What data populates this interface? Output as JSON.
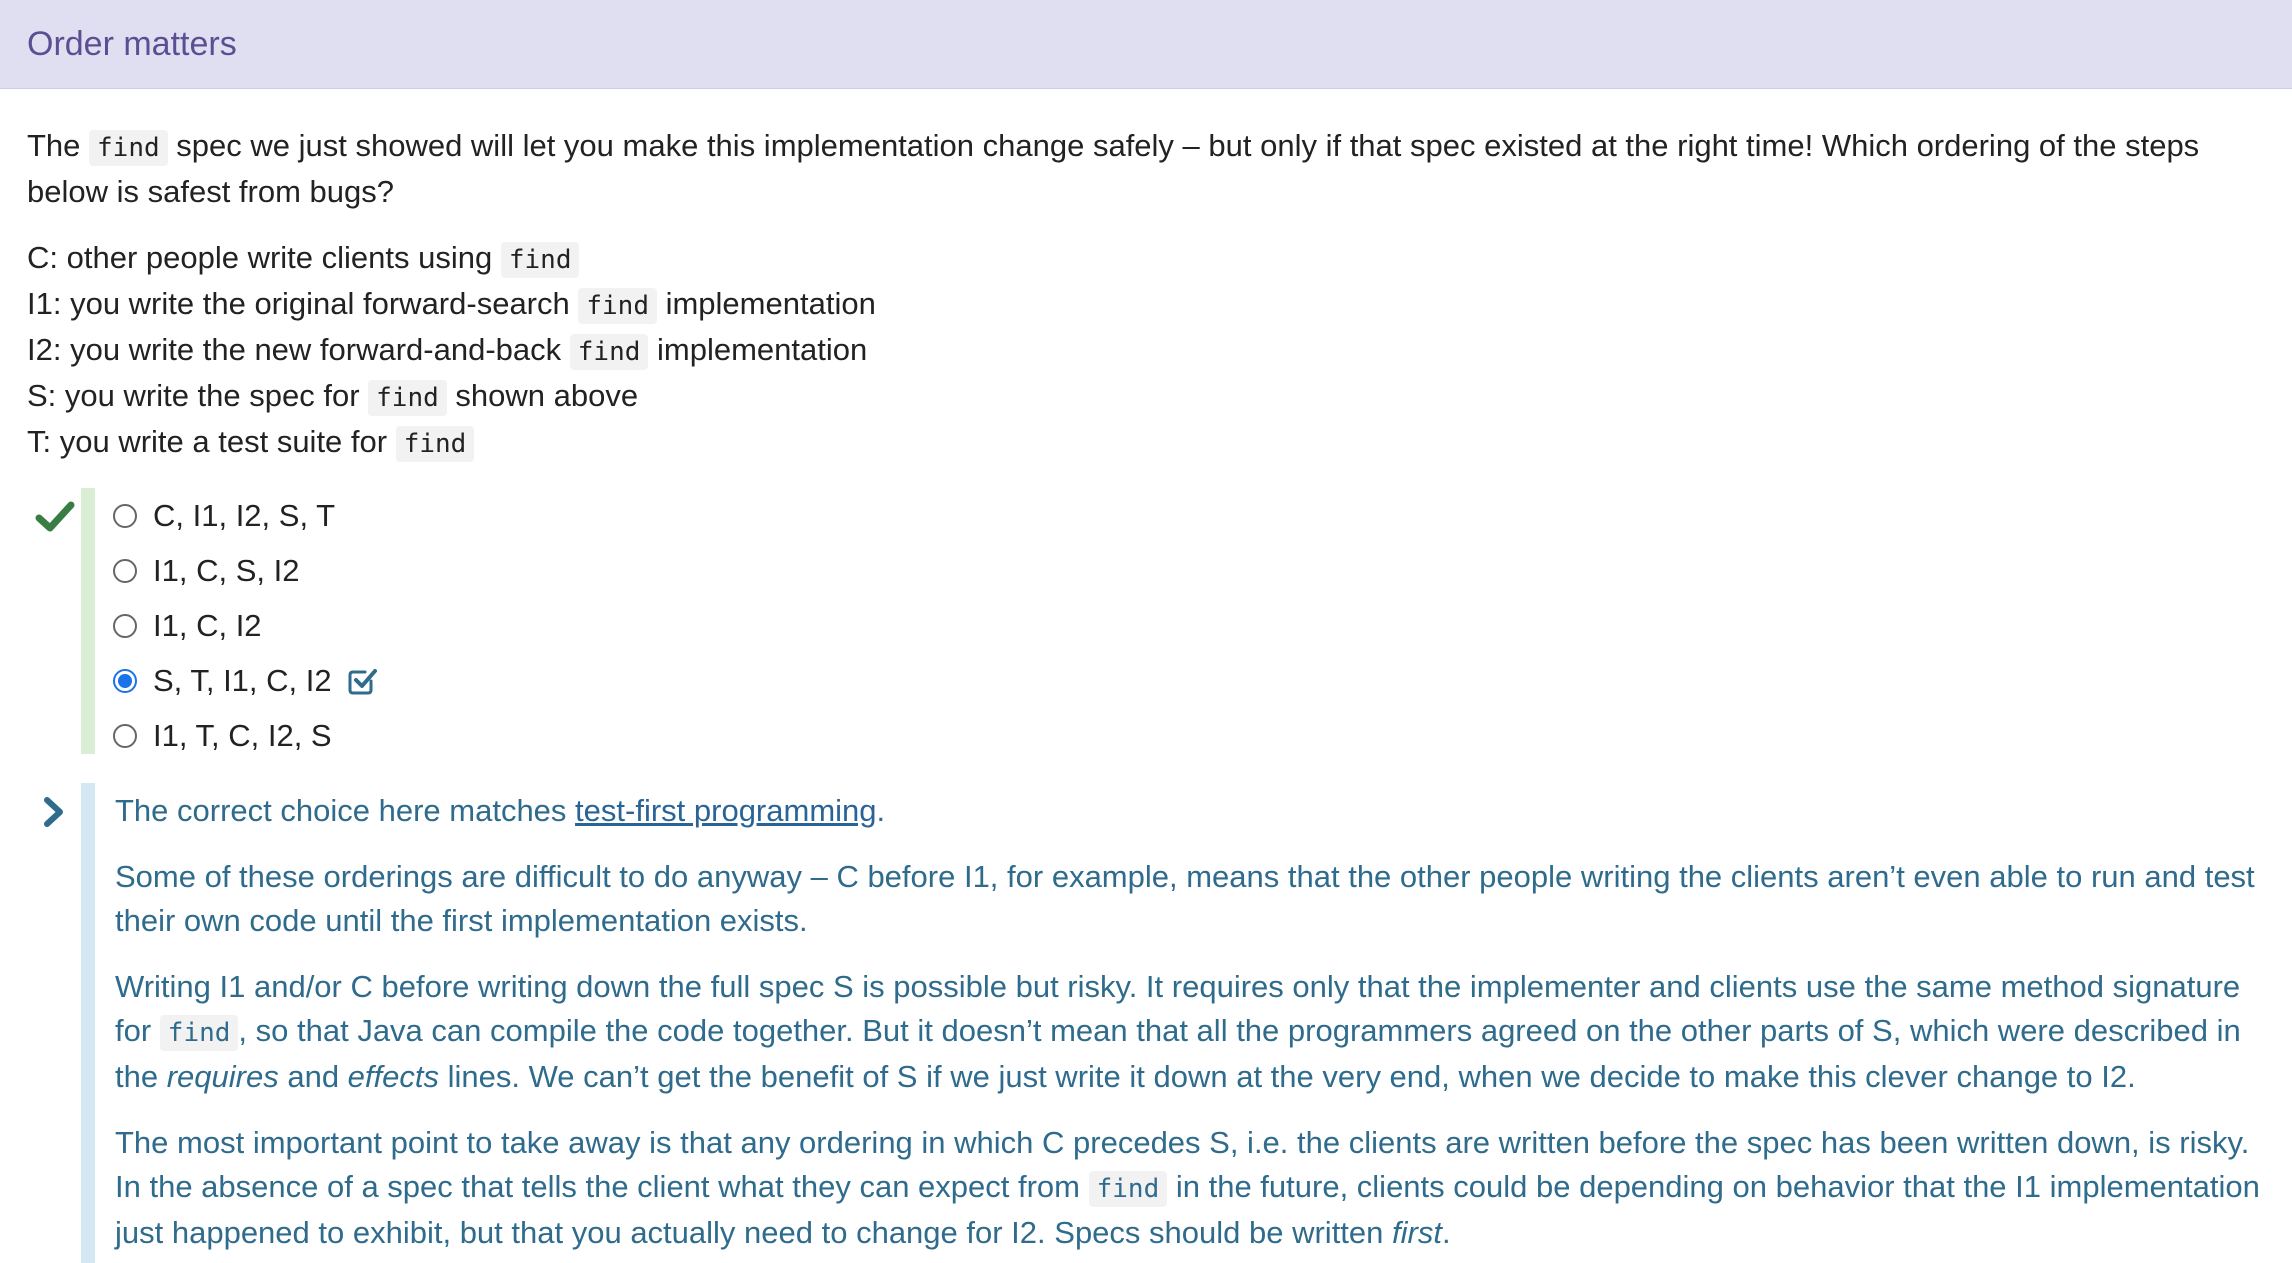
{
  "header": {
    "title": "Order matters"
  },
  "prompt": {
    "part1": "The ",
    "code": "find",
    "part2": " spec we just showed will let you make this implementation change safely – but only if that spec existed at the right time! Which ordering of the steps below is safest from bugs?"
  },
  "steps": [
    {
      "before": "C: other people write clients using ",
      "code": "find",
      "after": ""
    },
    {
      "before": "I1: you write the original forward-search ",
      "code": "find",
      "after": " implementation"
    },
    {
      "before": "I2: you write the new forward-and-back ",
      "code": "find",
      "after": " implementation"
    },
    {
      "before": "S: you write the spec for ",
      "code": "find",
      "after": " shown above"
    },
    {
      "before": "T: you write a test suite for ",
      "code": "find",
      "after": ""
    }
  ],
  "options": [
    {
      "label": "C, I1, I2, S, T",
      "selected": false
    },
    {
      "label": "I1, C, S, I2",
      "selected": false
    },
    {
      "label": "I1, C, I2",
      "selected": false
    },
    {
      "label": "S, T, I1, C, I2",
      "selected": true
    },
    {
      "label": "I1, T, C, I2, S",
      "selected": false
    }
  ],
  "icons": {
    "result": "checkmark-icon",
    "answer": "checked-box-icon",
    "explanation": "chevron-right-icon"
  },
  "explanation": {
    "p1": {
      "before": "The correct choice here matches ",
      "link": "test-first programming",
      "after": "."
    },
    "p2": "Some of these orderings are difficult to do anyway – C before I1, for example, means that the other people writing the clients aren’t even able to run and test their own code until the first implementation exists.",
    "p3": {
      "a": "Writing I1 and/or C before writing down the full spec S is possible but risky. It requires only that the implementer and clients use the same method signature for ",
      "code": "find",
      "b": ", so that Java can compile the code together. But it doesn’t mean that all the programmers agreed on the other parts of S, which were described in the ",
      "em1": "requires",
      "c": " and ",
      "em2": "effects",
      "d": " lines. We can’t get the benefit of S if we just write it down at the very end, when we decide to make this clever change to I2."
    },
    "p4": {
      "a": "The most important point to take away is that any ordering in which C precedes S, i.e. the clients are written before the spec has been written down, is risky. In the absence of a spec that tells the client what they can expect from ",
      "code": "find",
      "b": " in the future, clients could be depending on behavior that the I1 implementation just happened to exhibit, but that you actually need to change for I2. Specs should be written ",
      "em": "first",
      "c": "."
    }
  },
  "colors": {
    "header_bg": "#e0dff2",
    "header_text": "#5b4e93",
    "correct_green": "#3a7d44",
    "explanation_text": "#2f6b8c",
    "selected_blue": "#1a73e8"
  }
}
